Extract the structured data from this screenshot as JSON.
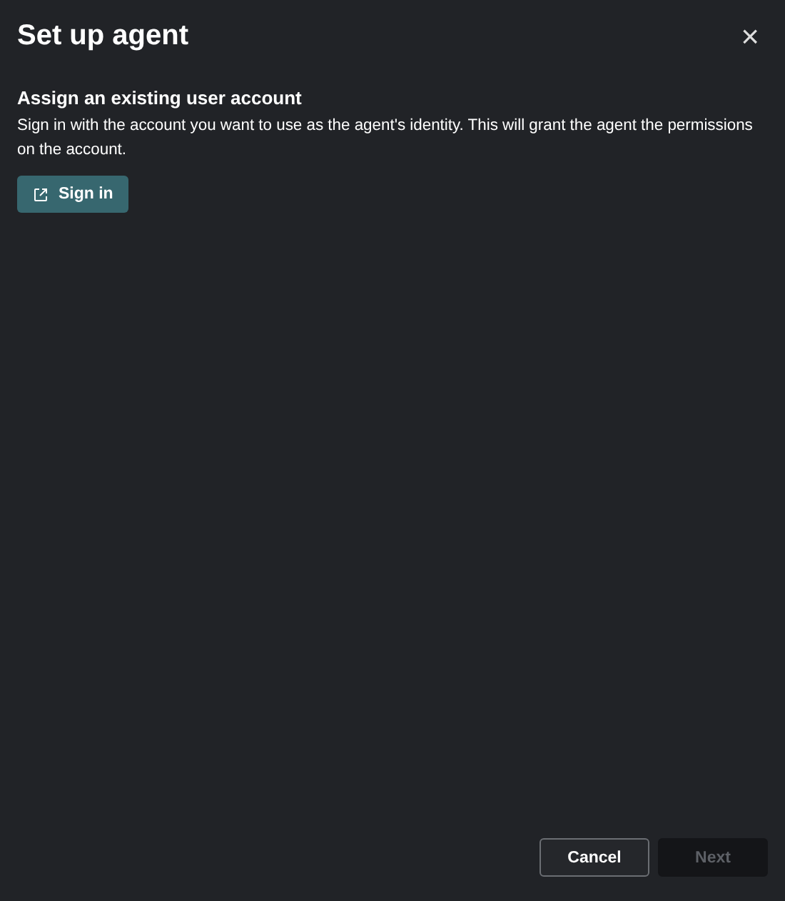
{
  "dialog": {
    "title": "Set up agent",
    "close": "×"
  },
  "section": {
    "heading": "Assign an existing user account",
    "description": "Sign in with the account you want to use as the agent's identity. This will grant the agent the permissions on the account.",
    "button": "Sign in"
  },
  "footer_buttons": [
    {
      "label": "Cancel",
      "disabled": false
    },
    {
      "label": "Next",
      "disabled": true
    }
  ]
}
